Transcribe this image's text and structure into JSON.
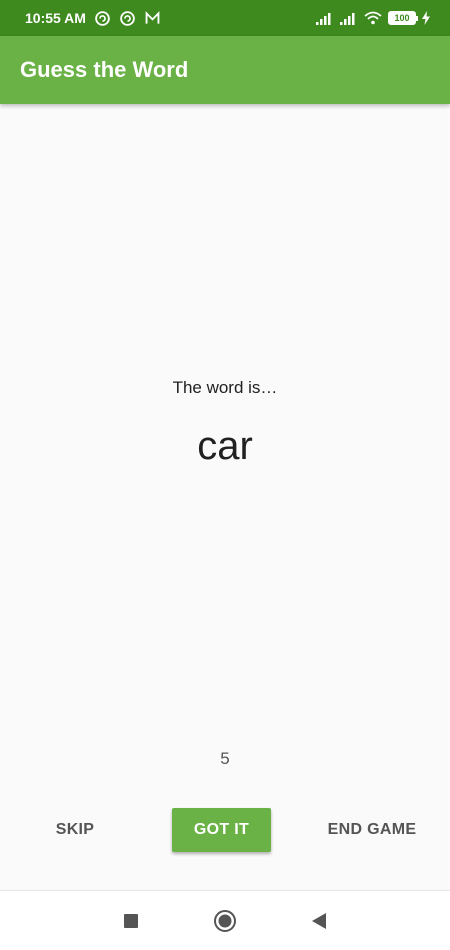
{
  "status_bar": {
    "time": "10:55 AM",
    "battery": "100",
    "icons": [
      "sync-icon",
      "sync-icon",
      "gmail-icon",
      "signal-icon",
      "signal-icon",
      "wifi-icon",
      "battery-icon",
      "charging-icon"
    ]
  },
  "app_bar": {
    "title": "Guess the Word"
  },
  "game": {
    "label": "The word is…",
    "word": "car",
    "timer": "5"
  },
  "buttons": {
    "skip": "SKIP",
    "got_it": "GOT IT",
    "end_game": "END GAME"
  },
  "colors": {
    "status_bar": "#3e8a1e",
    "primary": "#6ab146",
    "background": "#fafafa"
  },
  "nav_bar": {
    "icons": [
      "recents-icon",
      "home-icon",
      "back-icon"
    ]
  }
}
